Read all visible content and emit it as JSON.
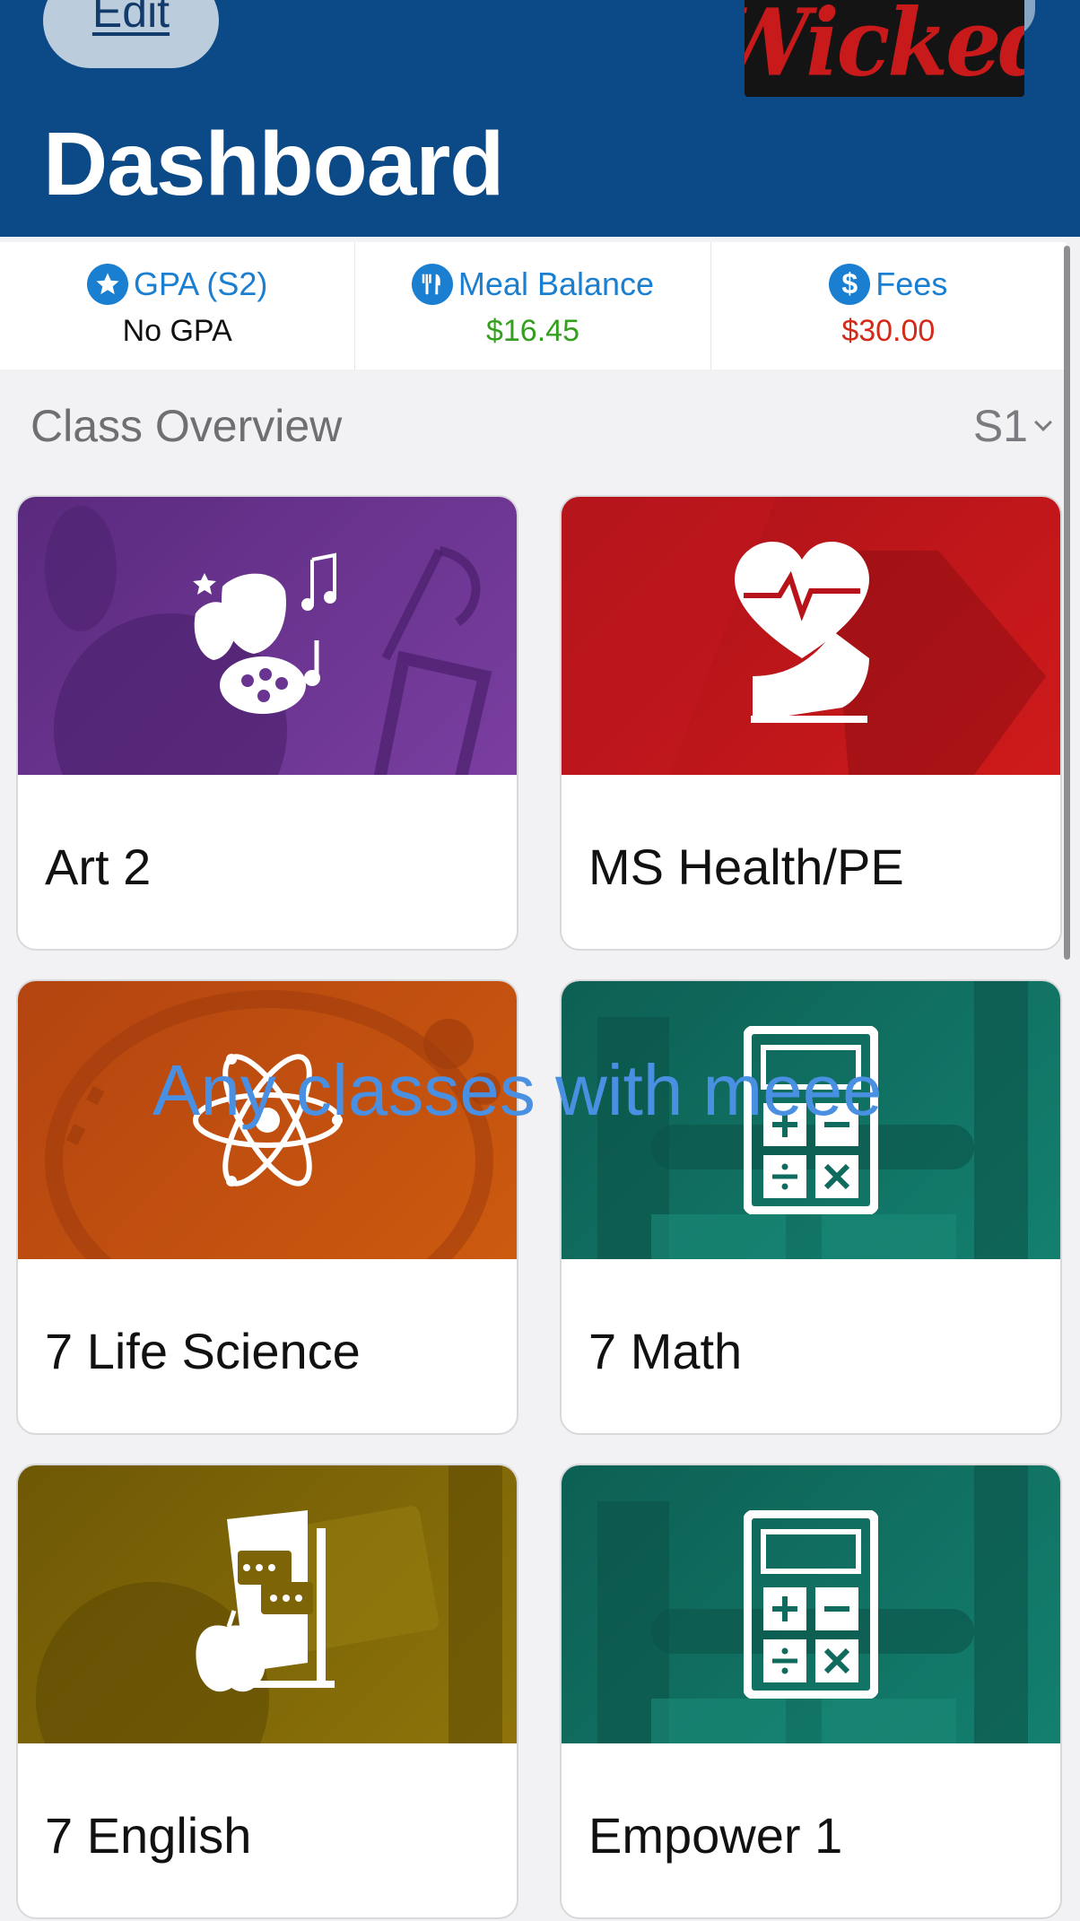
{
  "header": {
    "edit_label": "Edit",
    "sticker_text": "Wicked",
    "title": "Dashboard"
  },
  "stats": [
    {
      "icon": "star-icon",
      "label": "GPA (S2)",
      "value": "No GPA",
      "color": "#111111"
    },
    {
      "icon": "utensils-icon",
      "label": "Meal Balance",
      "value": "$16.45",
      "color": "#35a020"
    },
    {
      "icon": "dollar-icon",
      "label": "Fees",
      "value": "$30.00",
      "color": "#d42a1a"
    }
  ],
  "class_overview": {
    "title": "Class Overview",
    "term": "S1"
  },
  "classes": [
    {
      "name": "Art 2",
      "icon": "art-masks-palette-icon",
      "color": "#6a3591"
    },
    {
      "name": "MS Health/PE",
      "icon": "heart-shoe-icon",
      "color": "#b8121a"
    },
    {
      "name": "7 Life Science",
      "icon": "atom-icon",
      "color": "#c1510e"
    },
    {
      "name": "7 Math",
      "icon": "calculator-icon",
      "color": "#0f6b5e"
    },
    {
      "name": "7 English",
      "icon": "book-apple-icon",
      "color": "#7d6406"
    },
    {
      "name": "Empower 1",
      "icon": "calculator-icon",
      "color": "#0f6b5e"
    }
  ],
  "overlay_caption": "Any classes with meee"
}
